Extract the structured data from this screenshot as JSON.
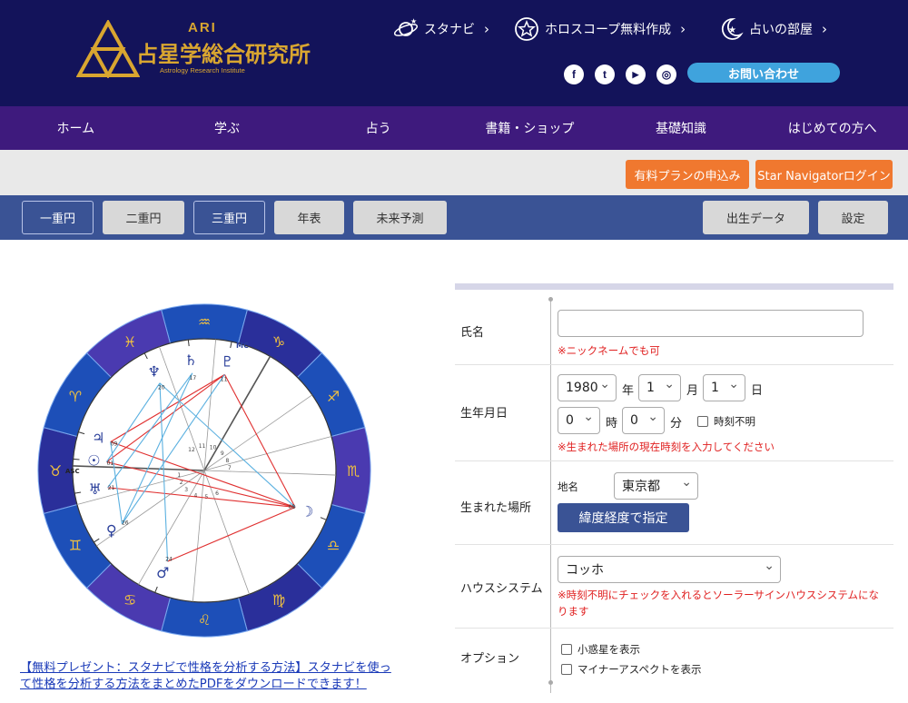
{
  "header": {
    "logo_ari": "ARI",
    "logo_title": "占星学総合研究所",
    "logo_sub": "Astrology Research Institute",
    "links": [
      {
        "label": "スタナビ",
        "icon": "planet-icon"
      },
      {
        "label": "ホロスコープ無料作成",
        "icon": "star-circle-icon"
      },
      {
        "label": "占いの部屋",
        "icon": "moon-star-icon"
      }
    ],
    "chev": "›",
    "social": [
      {
        "icon": "facebook-icon",
        "glyph": "f"
      },
      {
        "icon": "twitter-icon",
        "glyph": "t"
      },
      {
        "icon": "youtube-icon",
        "glyph": "▶"
      },
      {
        "icon": "instagram-icon",
        "glyph": "◎"
      }
    ],
    "contact_label": "お問い合わせ"
  },
  "nav": [
    "ホーム",
    "学ぶ",
    "占う",
    "書籍・ショップ",
    "基礎知識",
    "はじめての方へ"
  ],
  "subbar": {
    "paid_plan": "有料プランの申込み",
    "login": "Star Navigatorログイン"
  },
  "tabs": {
    "left": [
      "一重円",
      "二重円",
      "三重円",
      "年表",
      "未来予測"
    ],
    "right": [
      "出生データ",
      "設定"
    ]
  },
  "chart": {
    "signs": [
      "♒",
      "♑",
      "♐",
      "♏",
      "♎",
      "♍",
      "♌",
      "♋",
      "♊",
      "♉",
      "♈",
      "♓"
    ],
    "planets": [
      {
        "glyph": "♇",
        "deg": "11",
        "color": "#2a3f9a"
      },
      {
        "glyph": "♄",
        "deg": "17",
        "color": "#2a3f9a"
      },
      {
        "glyph": "♆",
        "deg": "20",
        "color": "#2a3f9a"
      },
      {
        "glyph": "♃",
        "deg": "09",
        "color": "#2a3f9a"
      },
      {
        "glyph": "☉",
        "deg": "01",
        "color": "#2a3f9a"
      },
      {
        "glyph": "♅",
        "deg": "21",
        "color": "#2a3f9a"
      },
      {
        "glyph": "☽",
        "deg": "08",
        "color": "#2a3f9a"
      },
      {
        "glyph": "♀",
        "deg": "26",
        "color": "#2a3f9a"
      },
      {
        "glyph": "♂",
        "deg": "24",
        "color": "#2a3f9a"
      }
    ],
    "asc_label": "ASC",
    "mc_label": "MC",
    "houses": [
      "1",
      "2",
      "3",
      "4",
      "5",
      "6",
      "7",
      "8",
      "9",
      "10",
      "11",
      "12"
    ]
  },
  "promo": "【無料プレゼント：スタナビで性格を分析する方法】スタナビを使って性格を分析する方法をまとめたPDFをダウンロードできます！",
  "form": {
    "name_label": "氏名",
    "name_value": "",
    "name_note": "※ニックネームでも可",
    "birth_label": "生年月日",
    "year": "1980",
    "year_unit": "年",
    "month": "1",
    "month_unit": "月",
    "day": "1",
    "day_unit": "日",
    "hour": "0",
    "hour_unit": "時",
    "minute": "0",
    "minute_unit": "分",
    "unknown_time": "時刻不明",
    "birth_note": "※生まれた場所の現在時刻を入力してください",
    "place_label": "生まれた場所",
    "place_name_label": "地名",
    "place_value": "東京都",
    "latlong_button": "緯度経度で指定",
    "house_label": "ハウスシステム",
    "house_value": "コッホ",
    "house_note": "※時刻不明にチェックを入れるとソーラーサインハウスシステムになります",
    "option_label": "オプション",
    "opt_minor_planets": "小惑星を表示",
    "opt_minor_aspects": "マイナーアスペクトを表示"
  }
}
